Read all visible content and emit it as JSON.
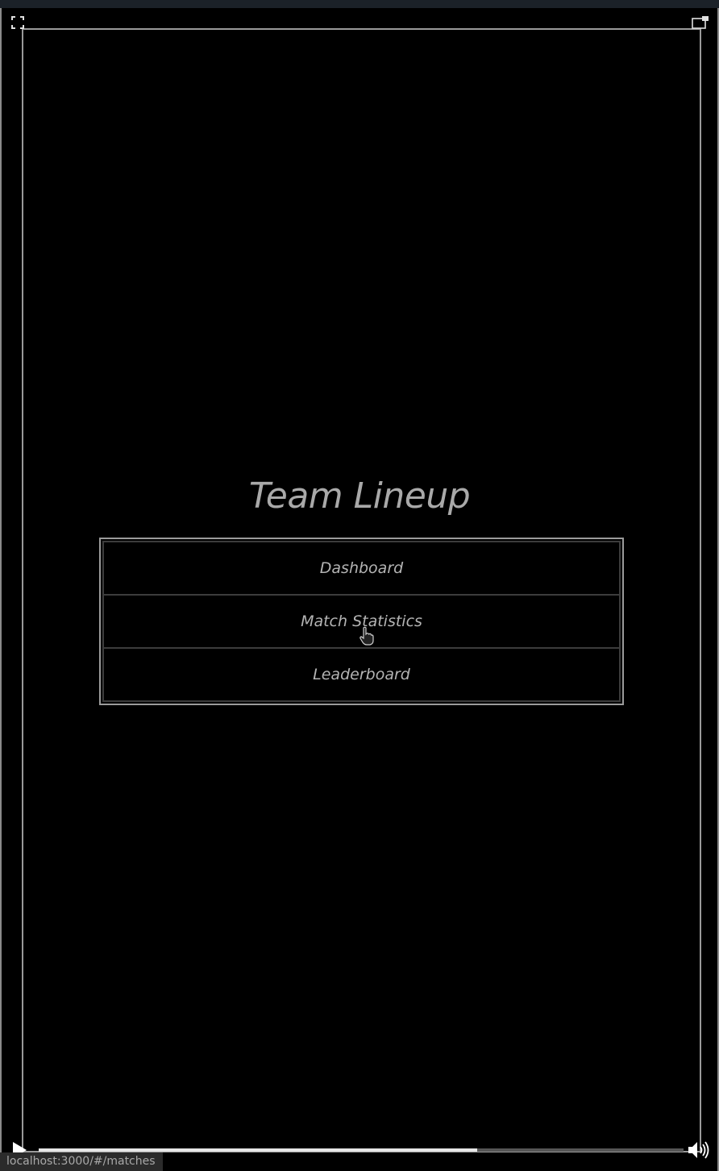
{
  "page": {
    "title": "Team Lineup"
  },
  "menu": {
    "items": [
      {
        "label": "Dashboard"
      },
      {
        "label": "Match Statistics"
      },
      {
        "label": "Leaderboard"
      }
    ]
  },
  "player": {
    "progress_fraction": 0.68,
    "icons": {
      "fullscreen": "fullscreen-icon",
      "popout": "popout-icon",
      "play": "play-icon",
      "volume": "volume-icon",
      "cursor": "hand-pointer-icon"
    }
  },
  "status_bar": {
    "url": "localhost:3000/#/matches"
  },
  "colors": {
    "background": "#000000",
    "text": "#b4b4b4",
    "frame": "#9a9a9a"
  }
}
